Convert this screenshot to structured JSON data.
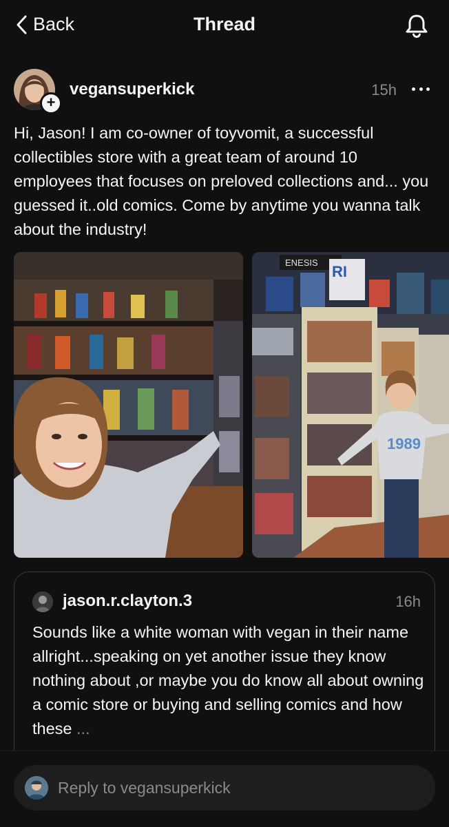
{
  "header": {
    "back_label": "Back",
    "title": "Thread"
  },
  "post": {
    "username": "vegansuperkick",
    "time": "15h",
    "text": "Hi, Jason! I am co-owner of toyvomit, a successful collectibles store with a great team of around 10 employees that focuses on preloved collections and... you guessed it..old comics. Come by anytime you wanna talk about the industry!"
  },
  "photos": {
    "photo2_sign_left": "ENESIS",
    "photo2_sign_right": "RI",
    "photo2_sweater": "1989"
  },
  "quoted": {
    "username": "jason.r.clayton.3",
    "time": "16h",
    "text": "Sounds like a white woman with vegan in their name allright...speaking on yet another issue they know nothing about ,or maybe you do know all about owning a comic store or buying and selling comics and how these",
    "ellipsis": "..."
  },
  "reply": {
    "placeholder": "Reply to vegansuperkick"
  },
  "colors": {
    "background": "#101010",
    "text": "#f3f5f7",
    "muted": "#8a8a8a",
    "border": "#3a3a3a"
  }
}
